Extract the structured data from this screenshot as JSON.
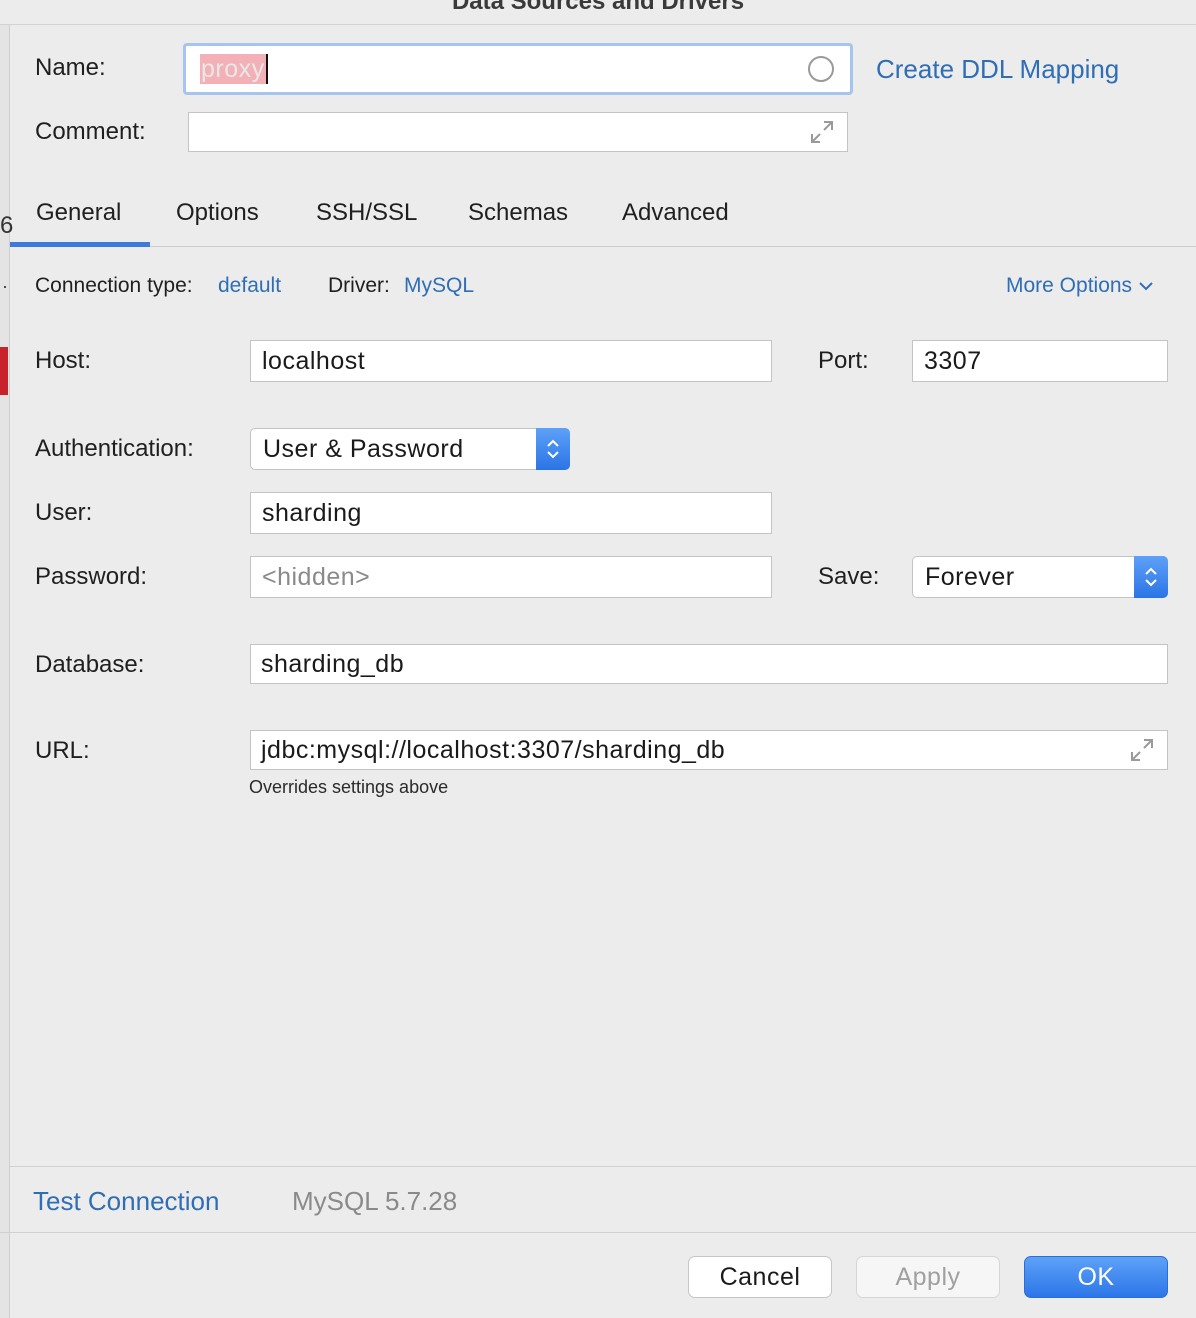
{
  "window": {
    "title": "Data Sources and Drivers"
  },
  "name_row": {
    "label": "Name:",
    "value": "proxy",
    "create_ddl_link": "Create DDL Mapping"
  },
  "comment_row": {
    "label": "Comment:",
    "value": ""
  },
  "tabs": [
    {
      "label": "General",
      "active": true
    },
    {
      "label": "Options",
      "active": false
    },
    {
      "label": "SSH/SSL",
      "active": false
    },
    {
      "label": "Schemas",
      "active": false
    },
    {
      "label": "Advanced",
      "active": false
    }
  ],
  "general": {
    "connection_type_label": "Connection type:",
    "connection_type_value": "default",
    "driver_label": "Driver:",
    "driver_value": "MySQL",
    "more_options": "More Options",
    "host_label": "Host:",
    "host_value": "localhost",
    "port_label": "Port:",
    "port_value": "3307",
    "auth_label": "Authentication:",
    "auth_value": "User & Password",
    "user_label": "User:",
    "user_value": "sharding",
    "password_label": "Password:",
    "password_placeholder": "<hidden>",
    "save_label": "Save:",
    "save_value": "Forever",
    "database_label": "Database:",
    "database_value": "sharding_db",
    "url_label": "URL:",
    "url_value": "jdbc:mysql://localhost:3307/sharding_db",
    "url_hint": "Overrides settings above"
  },
  "footer": {
    "test_connection": "Test Connection",
    "server_version": "MySQL 5.7.28",
    "cancel": "Cancel",
    "apply": "Apply",
    "ok": "OK"
  },
  "colors": {
    "accent": "#3d7ad9",
    "link": "#2f6eb5",
    "selection": "#f3b1b7",
    "sidebar_marker": "#c8232c"
  },
  "left_edge": {
    "glyph": "6",
    "dot": "·"
  }
}
